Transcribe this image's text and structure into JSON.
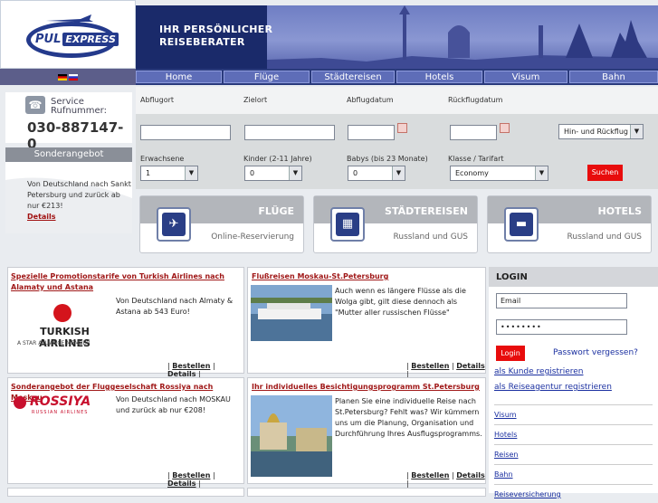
{
  "header": {
    "logo_main": "PUL",
    "logo_accent": "EXPRESS",
    "banner_line1": "IHR PERSÖNLICHER",
    "banner_line2": "REISEBERATER"
  },
  "nav": {
    "items": [
      "Home",
      "Flüge",
      "Städtereisen",
      "Hotels",
      "Visum",
      "Bahn"
    ]
  },
  "service": {
    "label_line1": "Service",
    "label_line2": "Rufnummer:",
    "phone": "030-887147- 0"
  },
  "offer": {
    "title": "Sonderangebot",
    "text": "Von Deutschland nach Sankt Petersburg und zurück ab nur €213!",
    "link": "Details"
  },
  "search": {
    "from_label": "Abflugort",
    "to_label": "Zielort",
    "depart_label": "Abflugdatum",
    "return_label": "Rückflugdatum",
    "trip_type": "Hin- und Rückflug",
    "adults_label": "Erwachsene",
    "adults_value": "1",
    "children_label": "Kinder (2-11 Jahre)",
    "children_value": "0",
    "babies_label": "Babys (bis 23 Monate)",
    "babies_value": "0",
    "class_label": "Klasse / Tarifart",
    "class_value": "Economy",
    "submit": "Suchen"
  },
  "cards": [
    {
      "title": "FLÜGE",
      "subtitle": "Online-Reservierung",
      "icon": "plane-icon"
    },
    {
      "title": "STÄDTEREISEN",
      "subtitle": "Russland und GUS",
      "icon": "city-icon"
    },
    {
      "title": "HOTELS",
      "subtitle": "Russland und GUS",
      "icon": "bed-icon"
    }
  ],
  "promos": [
    {
      "title": "Spezielle Promotionstarife von Turkish Airlines nach Alamaty und Astana",
      "text": "Von Deutschland nach Almaty & Astana ab 543 Euro!",
      "logo": "TURKISH AIRLINES",
      "logo_sub": "A STAR ALLIANCE MEMBER"
    },
    {
      "title": "Flußreisen Moskau-St.Petersburg",
      "text": "Auch wenn es längere Flüsse als die Wolga gibt, gilt diese dennoch als \"Mutter aller russischen Flüsse\""
    },
    {
      "title": "Sonderangebot der Fluggeselschaft Rossiya nach Moskau",
      "text": "Von Deutschland nach MOSKAU und zurück ab nur €208!",
      "logo": "ROSSIYA",
      "logo_sub": "RUSSIAN AIRLINES"
    },
    {
      "title": "Ihr individuelles Besichtigungsprogramm St.Petersburg",
      "text": "Planen Sie eine individuelle Reise nach St.Petersburg? Fehlt was? Wir kümmern uns um die Planung, Organisation und Durchführung Ihres Ausflugsprogramms."
    }
  ],
  "promo_actions": {
    "book": "Bestellen",
    "details": "Details",
    "sep": "|"
  },
  "login": {
    "title": "LOGIN",
    "email_placeholder": "Email",
    "password_value": "••••••••",
    "submit": "Login",
    "forgot": "Passwort vergessen?",
    "register_customer": "als Kunde registrieren",
    "register_agency": "als Reiseagentur registrieren",
    "menu": [
      "Visum",
      "Hotels",
      "Reisen",
      "Bahn",
      "Reiseversicherung"
    ]
  },
  "colors": {
    "navy": "#2a3a7c",
    "accent_red": "#e80c0c",
    "link_red": "#a01818"
  }
}
